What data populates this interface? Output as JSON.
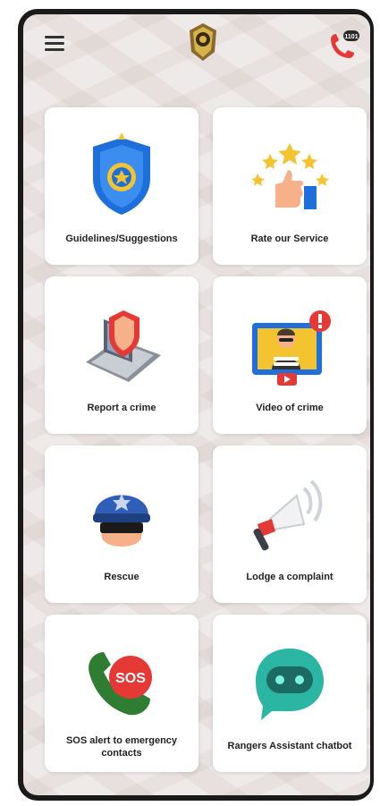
{
  "header": {
    "menu_icon": "hamburger-icon",
    "logo_icon": "rangers-emblem-icon",
    "emergency_call_icon": "emergency-phone-icon",
    "emergency_badge": "1101"
  },
  "cards": [
    {
      "label": "Guidelines/Suggestions",
      "icon": "police-badge-icon"
    },
    {
      "label": "Rate our Service",
      "icon": "thumbs-up-stars-icon"
    },
    {
      "label": "Report a crime",
      "icon": "laptop-shield-icon"
    },
    {
      "label": "Video of crime",
      "icon": "video-thief-icon"
    },
    {
      "label": "Rescue",
      "icon": "police-officer-icon"
    },
    {
      "label": "Lodge a complaint",
      "icon": "megaphone-icon"
    },
    {
      "label": "SOS alert to emergency contacts",
      "icon": "sos-phone-icon"
    },
    {
      "label": "Rangers Assistant chatbot",
      "icon": "chatbot-icon"
    }
  ],
  "colors": {
    "accent_red": "#e53935",
    "badge_blue": "#1e6fd9",
    "gold": "#f4c430",
    "background": "#efeaea"
  }
}
